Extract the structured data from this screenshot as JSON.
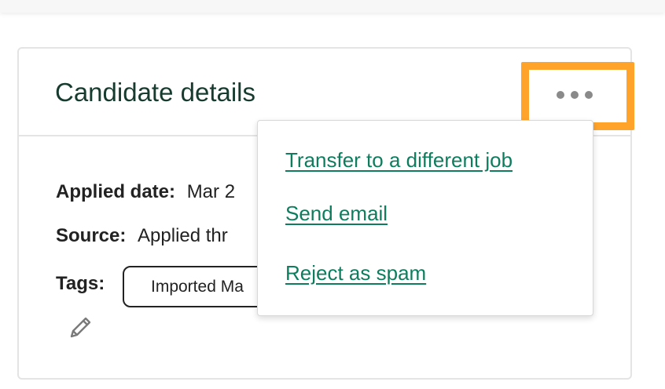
{
  "card": {
    "title": "Candidate details",
    "fields": {
      "applied_date": {
        "label": "Applied date:",
        "value": "Mar 2"
      },
      "source": {
        "label": "Source:",
        "value": "Applied thr"
      },
      "tags": {
        "label": "Tags:",
        "tag_value": "Imported Ma"
      }
    }
  },
  "more_menu": {
    "items": [
      "Transfer to a different job",
      "Send email",
      "Reject as spam"
    ]
  },
  "colors": {
    "title": "#173b2f",
    "link": "#0f7d5d",
    "highlight": "#ffa32b",
    "dots": "#8a8a8a"
  },
  "icons": {
    "more": "ellipsis-icon",
    "edit": "pencil-icon"
  }
}
